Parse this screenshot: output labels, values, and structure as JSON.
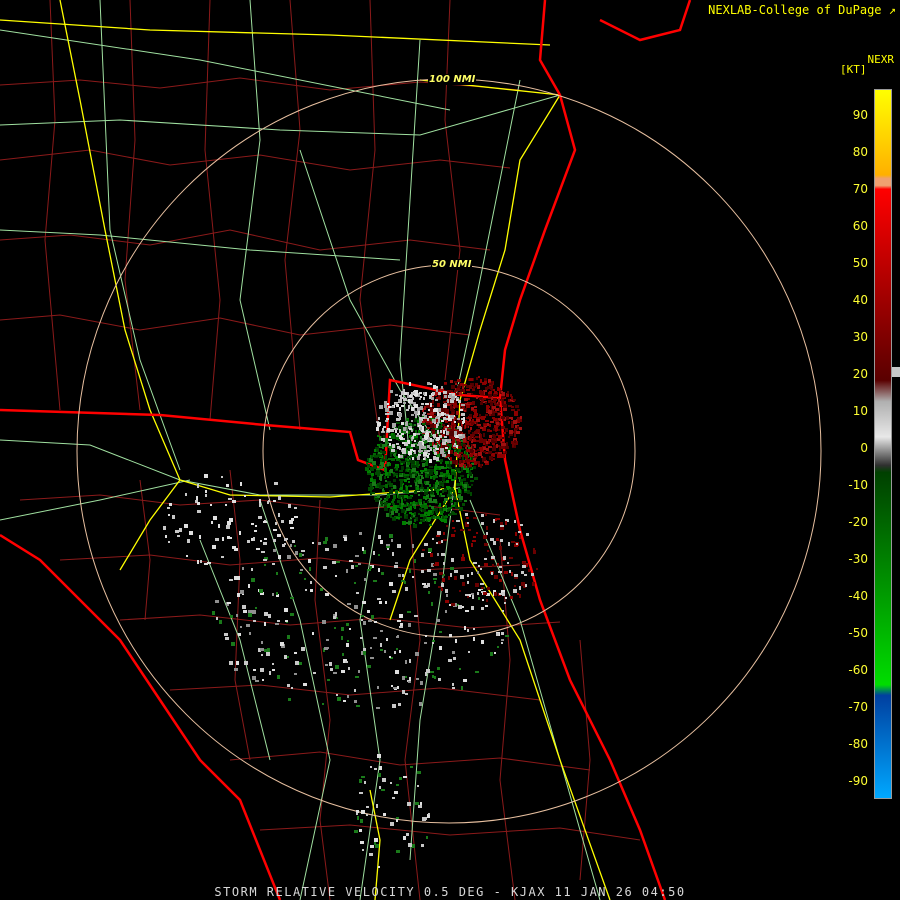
{
  "credit": "NEXLAB-College of DuPage",
  "credit_mark": "↗",
  "rings": [
    {
      "label": "100 NMI"
    },
    {
      "label": "50 NMI"
    }
  ],
  "scale": {
    "title": "NEXR",
    "unit": "[KT]",
    "ticks": [
      "90",
      "80",
      "70",
      "60",
      "50",
      "40",
      "30",
      "20",
      "10",
      "0",
      "-10",
      "-20",
      "-30",
      "-40",
      "-50",
      "-60",
      "-70",
      "-80",
      "-90"
    ],
    "colors": {
      "yellow": "#ffff00",
      "orange": "#f0a060",
      "red": "#ff0000",
      "dark_red": "#5a0000",
      "gray": "#c0c0c0",
      "dark_green": "#004000",
      "green": "#00cc00",
      "blue": "#0060c0",
      "light_blue": "#00a0ff"
    }
  },
  "map_colors": {
    "state_borders": "#ff0000",
    "county_lines": "#8b1a1a",
    "roads": "#a0e0a0",
    "interstates": "#ffff00",
    "range_rings": "#e8c0a0"
  },
  "footer": "STORM RELATIVE VELOCITY 0.5 DEG - KJAX 11 JAN 26 04:50"
}
